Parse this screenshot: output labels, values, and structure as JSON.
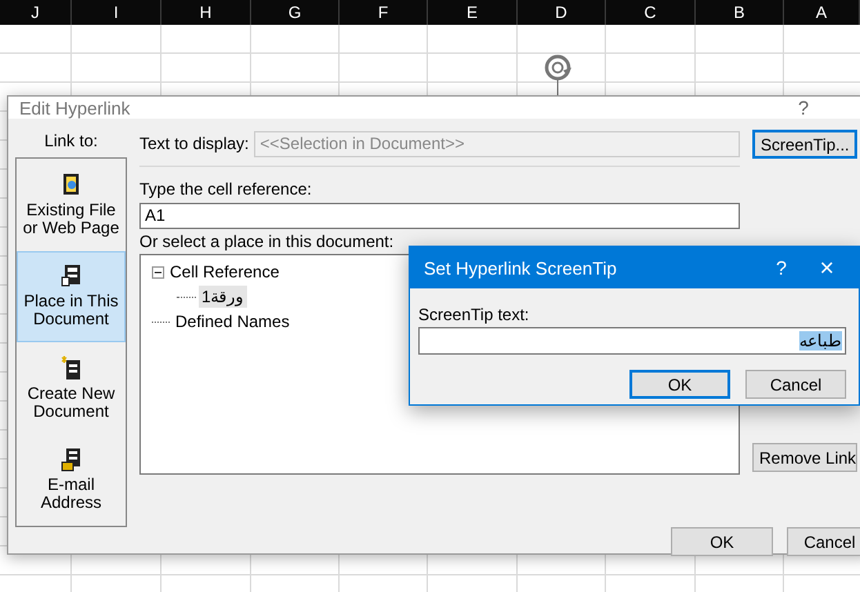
{
  "sheet": {
    "columns": [
      "J",
      "I",
      "H",
      "G",
      "F",
      "E",
      "D",
      "C",
      "B",
      "A"
    ]
  },
  "dialog": {
    "title": "Edit Hyperlink",
    "help": "?",
    "link_to_label": "Link to:",
    "link_to": [
      {
        "label": "Existing File or Web Page",
        "selected": false
      },
      {
        "label": "Place in This Document",
        "selected": true
      },
      {
        "label": "Create New Document",
        "selected": false
      },
      {
        "label": "E-mail Address",
        "selected": false
      }
    ],
    "text_to_display": {
      "label": "Text to display:",
      "value": "<<Selection in Document>>",
      "disabled": true
    },
    "cell_reference": {
      "label": "Type the cell reference:",
      "value": "A1"
    },
    "place_label": "Or select a place in this document:",
    "tree": [
      {
        "label": "Cell Reference",
        "expanded": true,
        "selected": false,
        "children": [
          {
            "label": "ورقة1",
            "selected": true
          }
        ]
      },
      {
        "label": "Defined Names",
        "selected": false
      }
    ],
    "side_buttons": [
      {
        "label": "ScreenTip...",
        "default": true
      },
      {
        "label": "Remove Link",
        "default": false
      }
    ],
    "buttons": [
      {
        "label": "OK",
        "default": false
      },
      {
        "label": "Cancel",
        "default": false
      }
    ]
  },
  "screentip_dialog": {
    "title": "Set Hyperlink ScreenTip",
    "help": "?",
    "close": "×",
    "field_label": "ScreenTip text:",
    "value": "طباعه",
    "value_selected": true,
    "buttons": [
      {
        "label": "OK",
        "default": true
      },
      {
        "label": "Cancel",
        "default": false
      }
    ]
  }
}
